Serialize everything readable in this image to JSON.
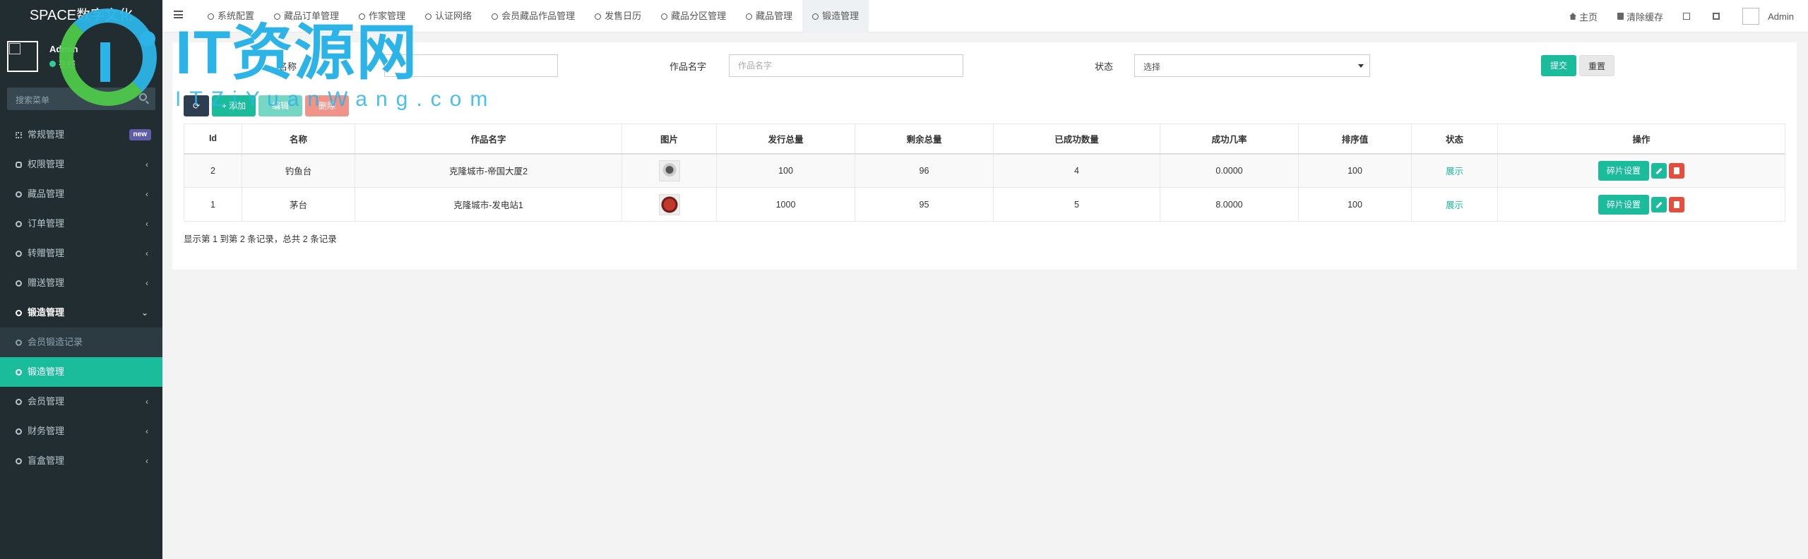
{
  "sidebar": {
    "brand": "SPACE数字文化",
    "user": {
      "name": "Admin",
      "status": "在线"
    },
    "search_placeholder": "搜索菜单",
    "items": [
      {
        "label": "常规管理",
        "badge": "new"
      },
      {
        "label": "权限管理"
      },
      {
        "label": "藏品管理"
      },
      {
        "label": "订单管理"
      },
      {
        "label": "转赠管理"
      },
      {
        "label": "赠送管理"
      },
      {
        "label": "锻造管理"
      },
      {
        "label": "会员锻造记录"
      },
      {
        "label": "锻造管理"
      },
      {
        "label": "会员管理"
      },
      {
        "label": "财务管理"
      },
      {
        "label": "盲盒管理"
      }
    ]
  },
  "topbar": {
    "tabs": [
      {
        "label": "系统配置"
      },
      {
        "label": "藏品订单管理"
      },
      {
        "label": "作家管理"
      },
      {
        "label": "认证网络"
      },
      {
        "label": "会员藏品作品管理"
      },
      {
        "label": "发售日历"
      },
      {
        "label": "藏品分区管理"
      },
      {
        "label": "藏品管理"
      },
      {
        "label": "锻造管理"
      }
    ],
    "right": {
      "home": "主页",
      "clear_cache": "清除缓存",
      "admin": "Admin"
    }
  },
  "watermark": {
    "title": "IT资源网",
    "subtitle": "ITZiYuanWang.com"
  },
  "filters": {
    "name_label": "名称",
    "work_label": "作品名字",
    "work_placeholder": "作品名字",
    "status_label": "状态",
    "status_value": "选择",
    "submit": "提交",
    "reset": "重置"
  },
  "toolbar": {
    "add": "添加",
    "edit": "编辑",
    "delete": "删除"
  },
  "table": {
    "headers": [
      "Id",
      "名称",
      "作品名字",
      "图片",
      "发行总量",
      "剩余总量",
      "已成功数量",
      "成功几率",
      "排序值",
      "状态",
      "操作"
    ],
    "rows": [
      {
        "id": "2",
        "name": "钓鱼台",
        "work": "克隆城市-帝国大厦2",
        "total": "100",
        "remain": "96",
        "success": "4",
        "rate": "0.0000",
        "sort": "100",
        "status": "展示",
        "op": "碎片设置"
      },
      {
        "id": "1",
        "name": "茅台",
        "work": "克隆城市-发电站1",
        "total": "1000",
        "remain": "95",
        "success": "5",
        "rate": "8.0000",
        "sort": "100",
        "status": "展示",
        "op": "碎片设置"
      }
    ],
    "pager": "显示第 1 到第 2 条记录，总共 2 条记录"
  }
}
